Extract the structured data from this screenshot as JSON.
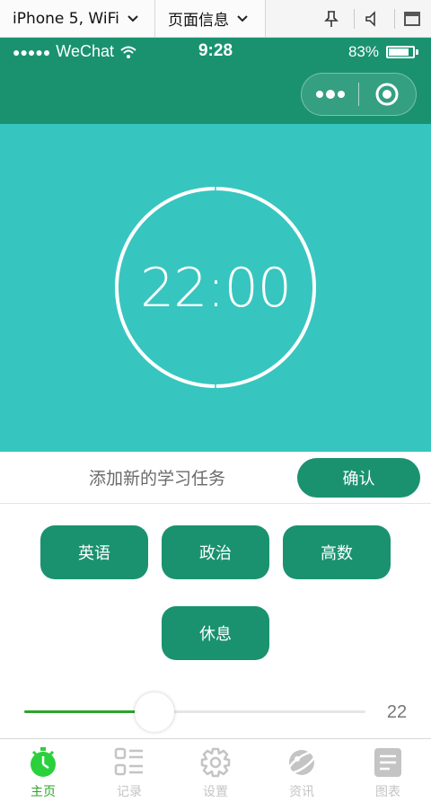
{
  "devtools": {
    "device_label": "iPhone 5, WiFi",
    "page_label": "页面信息"
  },
  "status_bar": {
    "signal_dots": "●●●●●",
    "carrier": "WeChat",
    "time": "9:28",
    "battery": "83%",
    "battery_level": 0.83
  },
  "capsule": {
    "more_icon": "more-dots-icon",
    "close_icon": "target-circle-icon"
  },
  "timer": {
    "display": "22:00"
  },
  "task": {
    "placeholder": "添加新的学习任务",
    "confirm_label": "确认"
  },
  "subjects": [
    "英语",
    "政治",
    "高数",
    "休息"
  ],
  "slider": {
    "value": "22",
    "min": 0,
    "max": 60,
    "current": 22
  },
  "tabbar": {
    "tabs": [
      {
        "label": "主页",
        "icon": "stopwatch-icon",
        "active": true
      },
      {
        "label": "记录",
        "icon": "list-icon",
        "active": false
      },
      {
        "label": "设置",
        "icon": "gear-icon",
        "active": false
      },
      {
        "label": "资讯",
        "icon": "planet-icon",
        "active": false
      },
      {
        "label": "图表",
        "icon": "chart-board-icon",
        "active": false
      }
    ]
  },
  "colors": {
    "header": "#1a9270",
    "timer_bg": "#37c5bf",
    "button": "#1a9270",
    "active_tab": "#2aa52a"
  }
}
